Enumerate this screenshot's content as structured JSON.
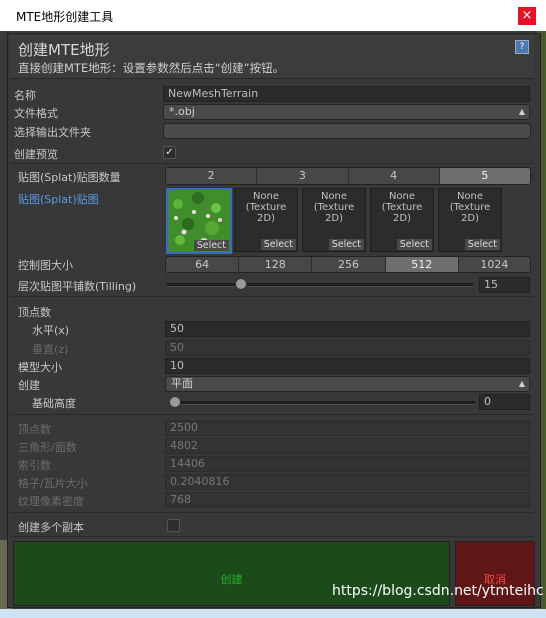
{
  "window": {
    "title": "MTE地形创建工具",
    "close": "×"
  },
  "header": {
    "title": "创建MTE地形",
    "subtitle": "直接创建MTE地形：设置参数然后点击“创建”按钮。",
    "help": "?"
  },
  "fields": {
    "name_label": "名称",
    "name_value": "NewMeshTerrain",
    "format_label": "文件格式",
    "format_value": "*.obj",
    "folder_label": "选择输出文件夹",
    "folder_value": "",
    "preview_label": "创建预览",
    "preview_checked": "✓"
  },
  "splat": {
    "count_label": "贴图(Splat)贴图数量",
    "count_options": [
      "2",
      "3",
      "4",
      "5"
    ],
    "count_selected": "5",
    "textures_label": "贴图(Splat)贴图",
    "textures": [
      {
        "none": "",
        "select": "Select"
      },
      {
        "none": "None\n(Texture\n2D)",
        "select": "Select"
      },
      {
        "none": "None\n(Texture\n2D)",
        "select": "Select"
      },
      {
        "none": "None\n(Texture\n2D)",
        "select": "Select"
      },
      {
        "none": "None\n(Texture\n2D)",
        "select": "Select"
      }
    ],
    "control_label": "控制图大小",
    "control_options": [
      "64",
      "128",
      "256",
      "512",
      "1024"
    ],
    "control_selected": "512",
    "tiling_label": "层次贴图平铺数(Tilling)",
    "tiling_value": "15",
    "tiling_fraction": 0.23
  },
  "vertex": {
    "section_label": "顶点数",
    "h_label": "水平(x)",
    "h_value": "50",
    "v_label": "垂直(z)",
    "v_value": "50",
    "size_label": "模型大小",
    "size_value": "10",
    "create_label": "创建",
    "create_value": "平面",
    "base_label": "基础高度",
    "base_value": "0",
    "base_fraction": 0.0
  },
  "stats": {
    "vertex_label": "顶点数",
    "vertex_value": "2500",
    "tri_label": "三角形/面数",
    "tri_value": "4802",
    "index_label": "索引数",
    "index_value": "14406",
    "grid_label": "格子/瓦片大小",
    "grid_value": "0.2040816",
    "texel_label": "纹理像素密度",
    "texel_value": "768"
  },
  "multi": {
    "label": "创建多个副本"
  },
  "buttons": {
    "create": "创建",
    "cancel": "取消"
  },
  "watermark": "https://blog.csdn.net/ytmteihc"
}
